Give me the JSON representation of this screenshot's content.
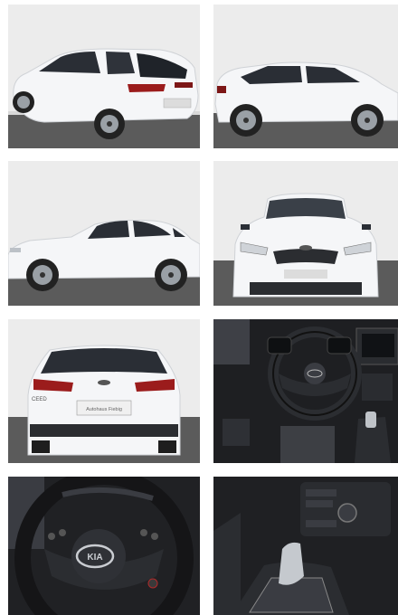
{
  "gallery": {
    "photos": [
      {
        "name": "rear-left-three-quarter",
        "plate_text": ""
      },
      {
        "name": "right-side-profile"
      },
      {
        "name": "left-side-profile"
      },
      {
        "name": "front-view"
      },
      {
        "name": "rear-view",
        "badge_text": "CEED",
        "plate_watermark": "Autohaus Fiebig"
      },
      {
        "name": "dashboard-interior"
      },
      {
        "name": "steering-wheel-closeup",
        "logo_text": "KIA"
      },
      {
        "name": "gear-shifter-console"
      }
    ],
    "logo_text": "KIA"
  },
  "colors": {
    "car_body": "#f4f5f7",
    "road": "#5a5a5a",
    "studio_wall": "#e8e8e8",
    "interior_dark": "#1e1f22",
    "tail_light": "#9b1c1c"
  }
}
